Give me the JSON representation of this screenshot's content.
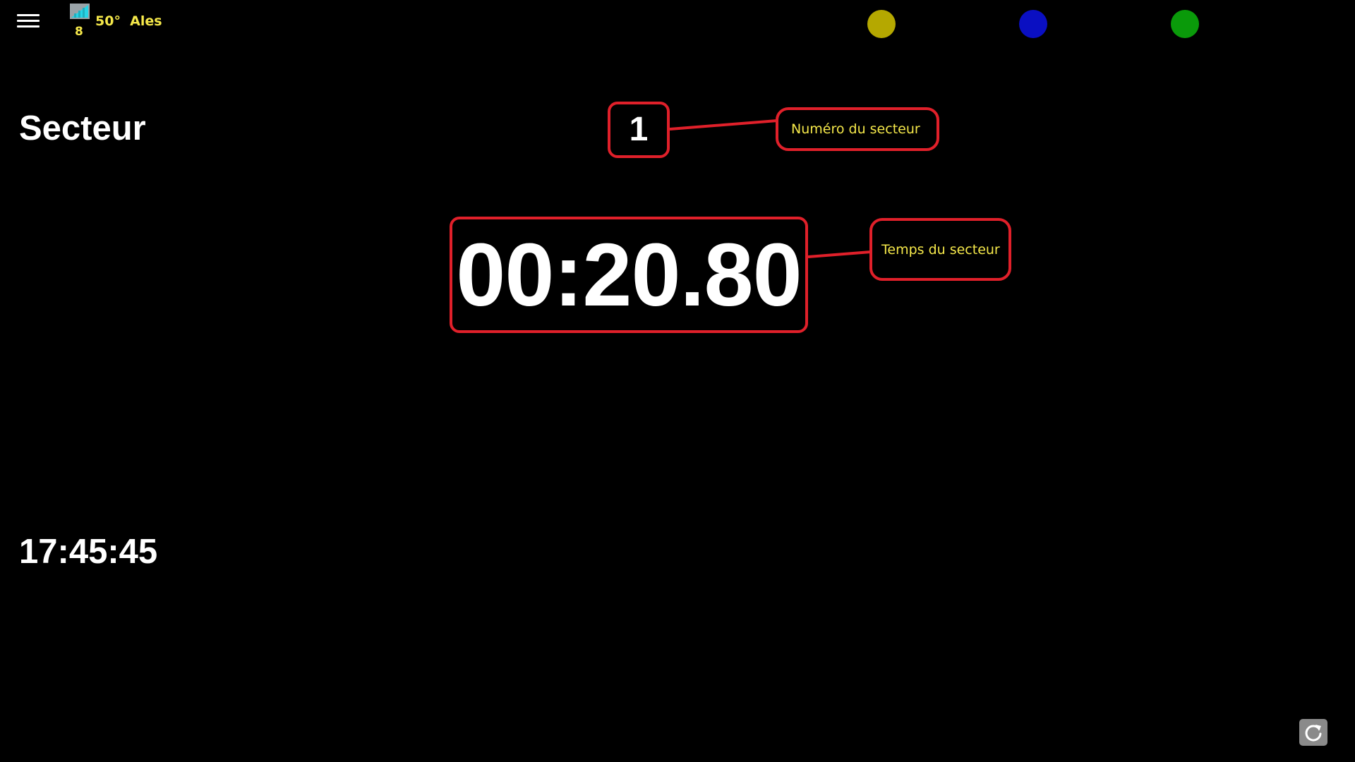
{
  "header": {
    "menu_icon": "hamburger-menu-icon",
    "signal_icon": "signal-strength-icon",
    "signal_count": "8",
    "temperature_city": "50°  Ales",
    "status_indicators": [
      {
        "name": "yellow",
        "color": "#b5a800"
      },
      {
        "name": "blue",
        "color": "#0a0fc2"
      },
      {
        "name": "green",
        "color": "#0a9a0a"
      }
    ]
  },
  "main": {
    "sector_label": "Secteur",
    "sector_number": "1",
    "sector_time": "00:20.80",
    "clock": "17:45:45"
  },
  "annotations": {
    "sector_number_callout": "Numéro du secteur",
    "sector_time_callout": "Temps du secteur",
    "border_color": "#e0202a",
    "text_color": "#f5e84a"
  },
  "footer": {
    "refresh_icon": "refresh-icon"
  }
}
